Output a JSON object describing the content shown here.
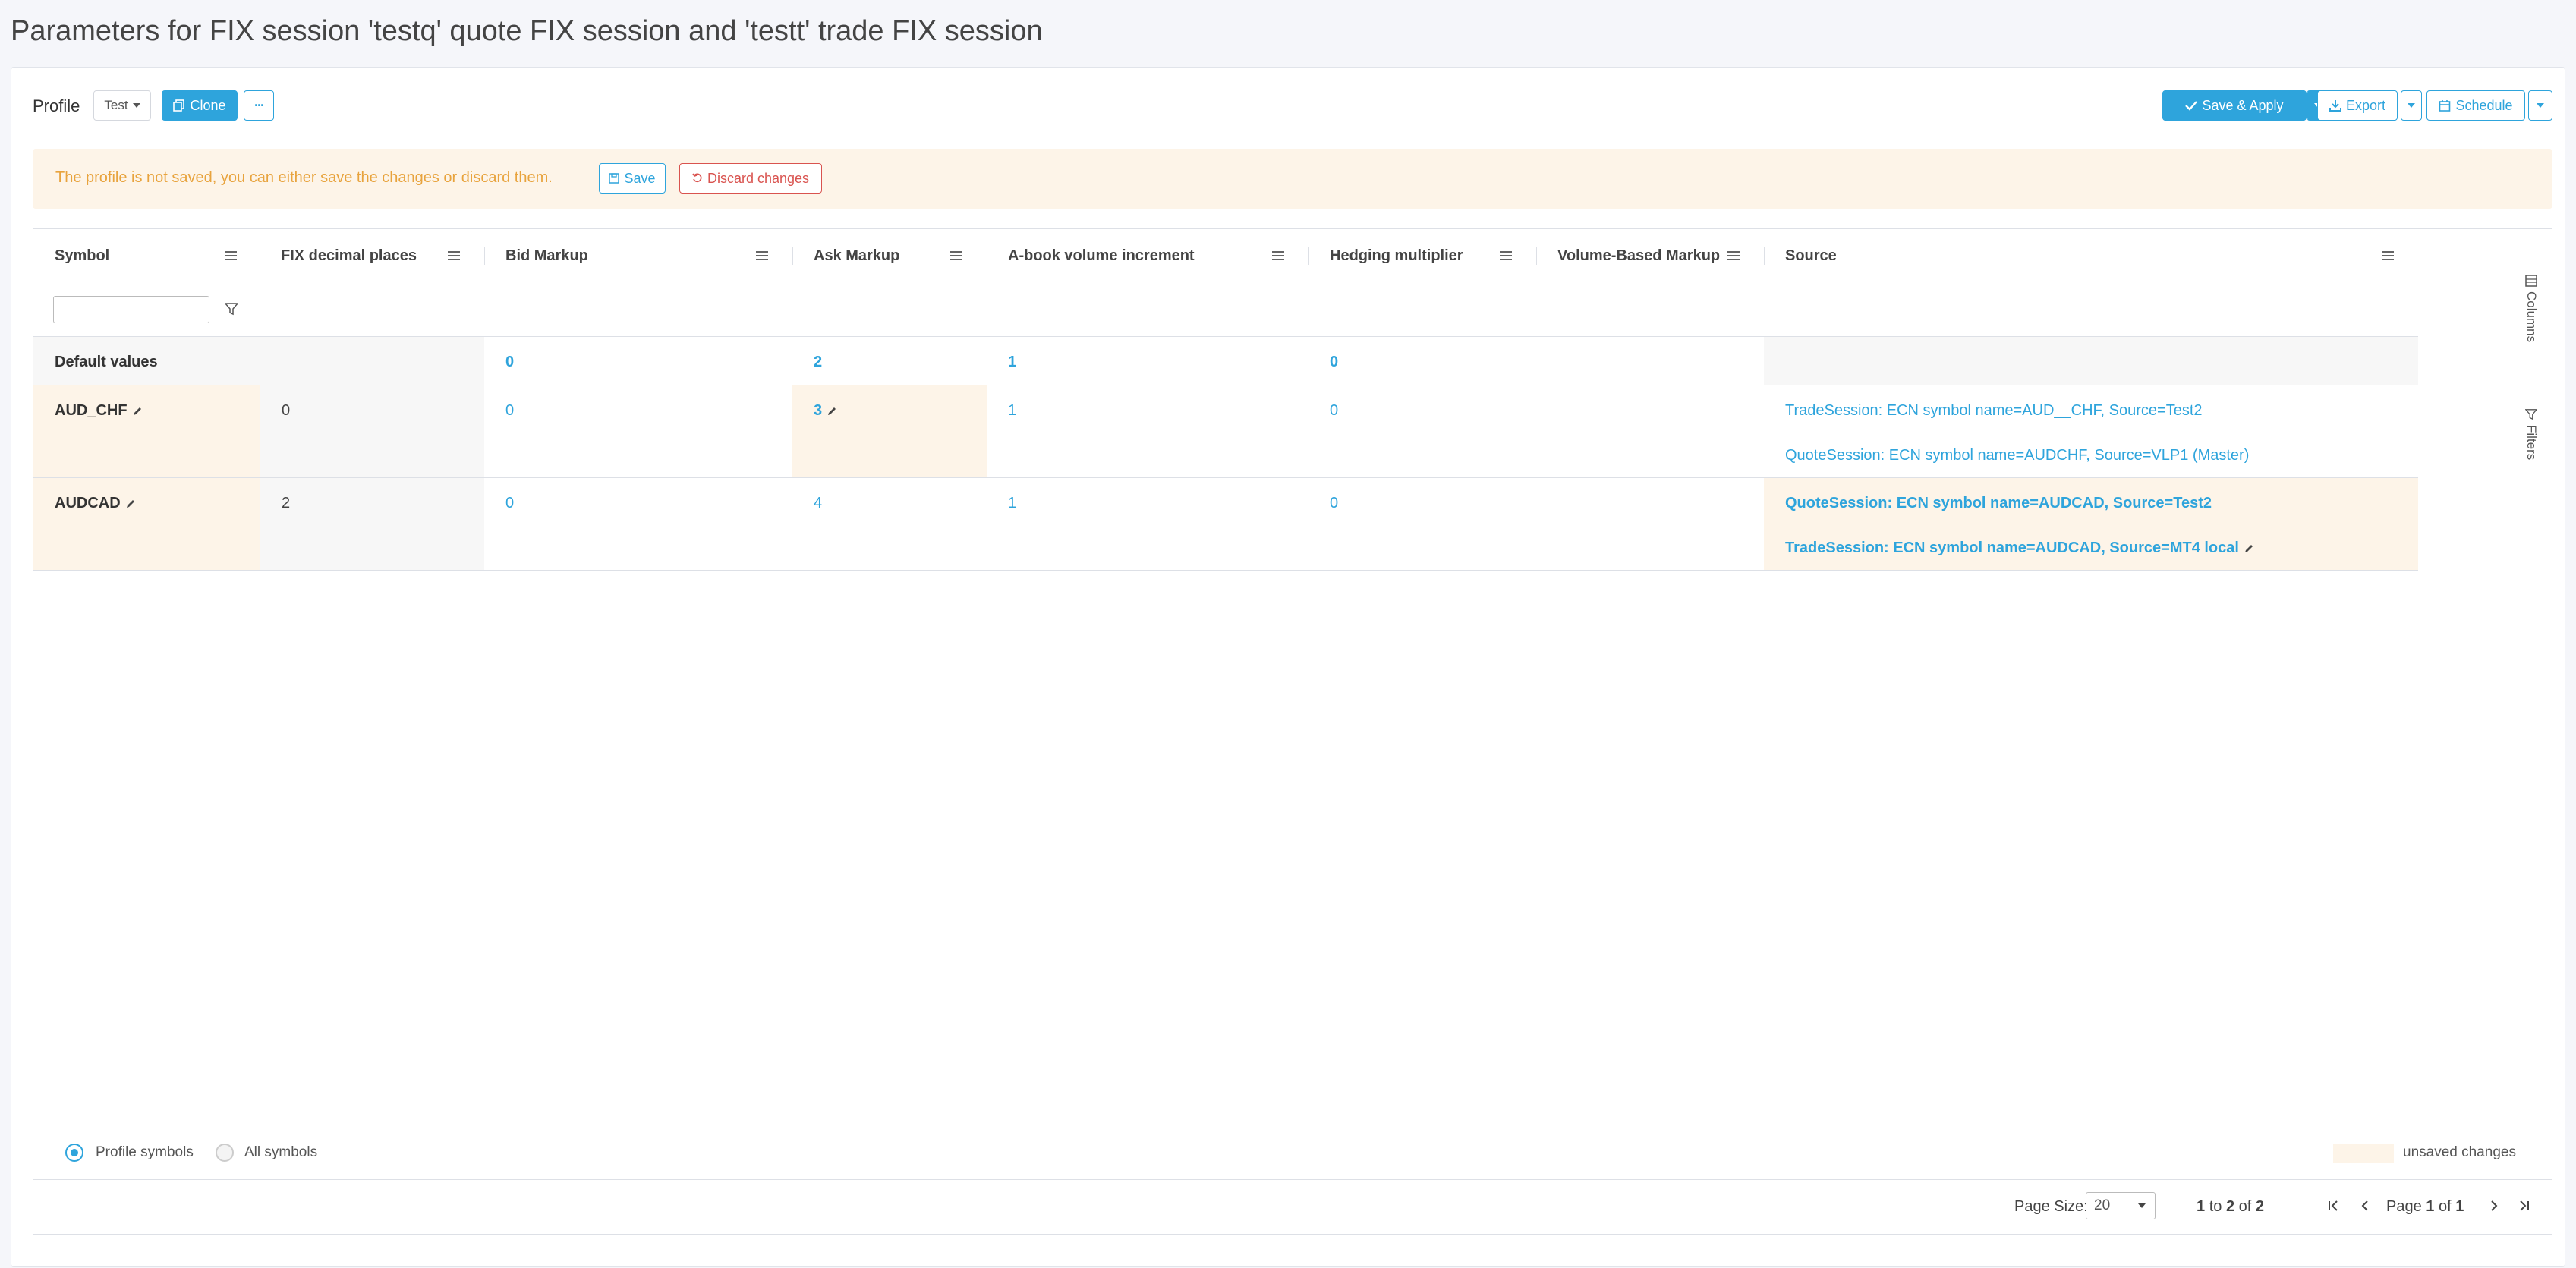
{
  "page": {
    "title": "Parameters for FIX session 'testq' quote FIX session and 'testt' trade FIX session"
  },
  "toolbar": {
    "profile_label": "Profile",
    "profile_value": "Test",
    "clone_label": "Clone",
    "more_label": "···",
    "save_apply_label": "Save & Apply",
    "export_label": "Export",
    "schedule_label": "Schedule"
  },
  "alert": {
    "message": "The profile is not saved, you can either save the changes or discard them.",
    "save_label": "Save",
    "discard_label": "Discard changes"
  },
  "grid": {
    "columns": [
      "Symbol",
      "FIX decimal places",
      "Bid Markup",
      "Ask Markup",
      "A-book volume increment",
      "Hedging multiplier",
      "Volume-Based Markup",
      "Source"
    ],
    "defaults": {
      "label": "Default values",
      "bid_markup": "0",
      "ask_markup": "2",
      "abook_volume_increment": "1",
      "hedging_multiplier": "0"
    },
    "rows": [
      {
        "symbol": "AUD_CHF",
        "fix_decimal_places": "0",
        "bid_markup": "0",
        "ask_markup": "3",
        "abook_volume_increment": "1",
        "hedging_multiplier": "0",
        "volume_based_markup": "",
        "source_1": "TradeSession: ECN symbol name=AUD__CHF, Source=Test2",
        "source_2": "QuoteSession: ECN symbol name=AUDCHF, Source=VLP1 (Master)"
      },
      {
        "symbol": "AUDCAD",
        "fix_decimal_places": "2",
        "bid_markup": "0",
        "ask_markup": "4",
        "abook_volume_increment": "1",
        "hedging_multiplier": "0",
        "volume_based_markup": "",
        "source_1": "QuoteSession: ECN symbol name=AUDCAD, Source=Test2",
        "source_2": "TradeSession: ECN symbol name=AUDCAD, Source=MT4 local"
      }
    ],
    "side_tabs": {
      "columns": "Columns",
      "filters": "Filters"
    }
  },
  "footer": {
    "profile_symbols": "Profile symbols",
    "all_symbols": "All symbols",
    "legend_unsaved": "unsaved changes",
    "page_size_label": "Page Size:",
    "page_size_value": "20",
    "range_from": "1",
    "range_to_word": "to",
    "range_to": "2",
    "range_of_word": "of",
    "range_total": "2",
    "page_word": "Page",
    "page_current": "1",
    "page_of_word": "of",
    "page_total": "1"
  },
  "colors": {
    "accent": "#2ea4dc",
    "unsaved_bg": "#fdf4e8",
    "warning_text": "#e8a33d",
    "danger": "#d9534f"
  }
}
